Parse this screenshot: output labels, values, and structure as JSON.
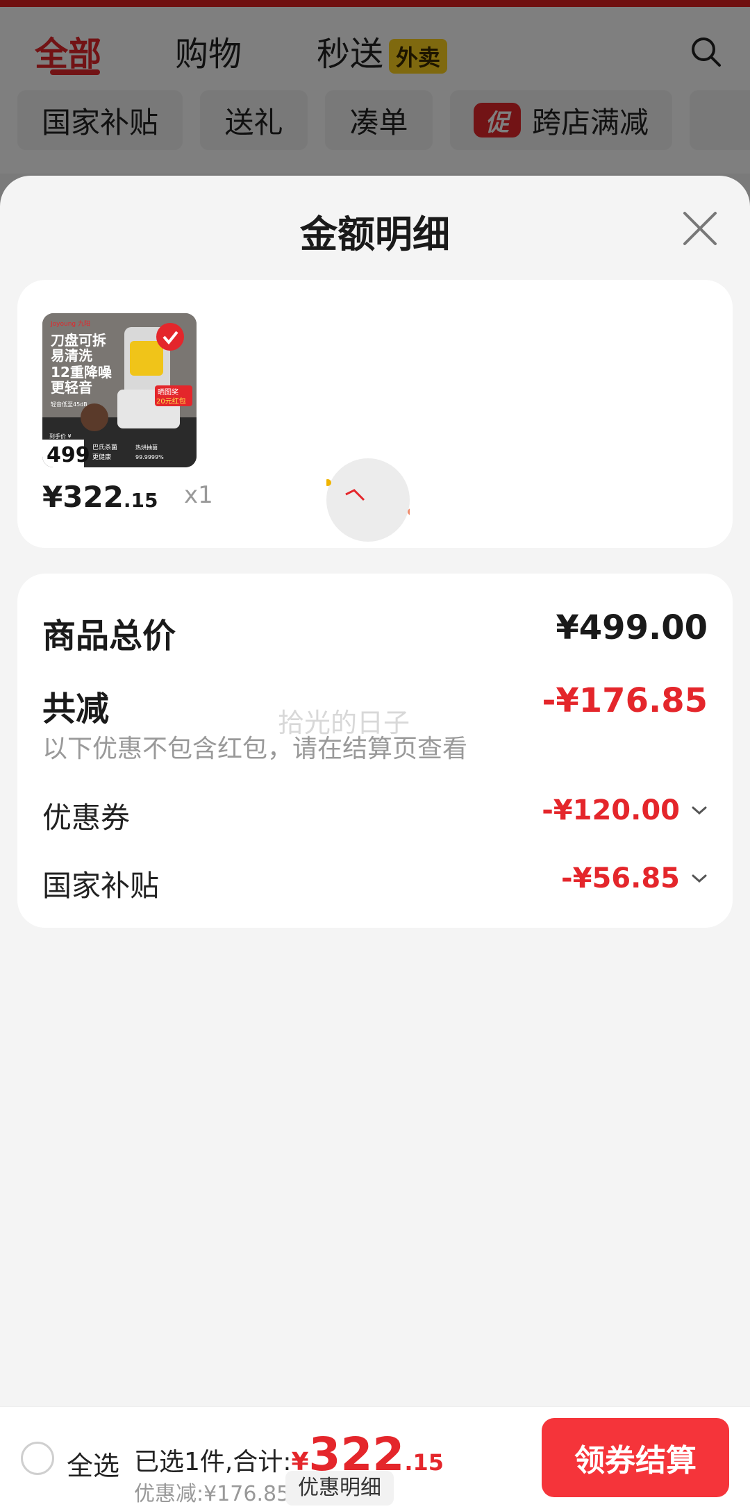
{
  "nav": {
    "tabs": [
      "全部",
      "购物",
      "秒送"
    ],
    "waimai_tag": "外卖",
    "chips": [
      "国家补贴",
      "送礼",
      "凑单"
    ],
    "promo_badge": "促",
    "promo_chip": "跨店满减"
  },
  "sheet": {
    "title": "金额明细",
    "product": {
      "image_texts": {
        "brand": "Joyoung 九阳",
        "line1": "刀盘可拆",
        "line2": "易清洗",
        "line3": "12重降噪",
        "line4": "更轻音",
        "small": "轻音低至45dB",
        "badge": "晒图奖",
        "badge2": "20元红包",
        "price_label": "到手价 ¥",
        "price": "499",
        "tag_a": "巴氏杀菌",
        "tag_a2": "更健康",
        "tag_b": "热烘抽菌",
        "tag_b2": "99.9999%"
      },
      "price_main": "¥322",
      "price_dec": ".15",
      "qty": "x1"
    },
    "summary": {
      "total_label": "商品总价",
      "total_value": "¥499.00",
      "discount_label": "共减",
      "discount_value": "-¥176.85",
      "note": "以下优惠不包含红包，请在结算页查看",
      "items": [
        {
          "label": "优惠券",
          "value": "-¥120.00"
        },
        {
          "label": "国家补贴",
          "value": "-¥56.85"
        }
      ]
    },
    "watermark": "拾光的日子"
  },
  "bottom": {
    "select_all": "全选",
    "selected_text": "已选1件,合计:",
    "total_yen": "¥",
    "total_int": "322",
    "total_dec": ".15",
    "discount_text": "优惠减:¥176.85",
    "detail_button": "优惠明细",
    "checkout_button": "领券结算"
  },
  "colors": {
    "accent": "#e4262b",
    "checkout": "#f5343a",
    "waimai": "#ffd21e"
  }
}
